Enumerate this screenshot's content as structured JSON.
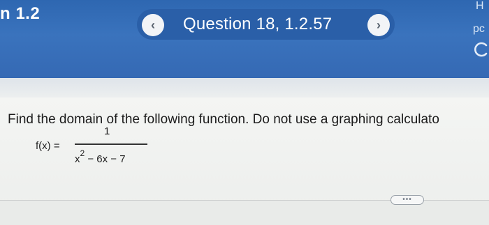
{
  "header": {
    "section_title": "n 1.2",
    "question_label": "Question 18, 1.2.57",
    "prev_glyph": "‹",
    "next_glyph": "›",
    "right_top_text": "H",
    "right_mid_text": "pc",
    "accent_color": "#3a73bd"
  },
  "problem": {
    "instruction": "Find the domain of the following function. Do not use a graphing calculato",
    "function_lhs": "f(x) =",
    "numerator": "1",
    "denominator_base": "x",
    "denominator_exp": "2",
    "denominator_rest": " − 6x − 7"
  },
  "footer": {
    "more_label": "•••"
  }
}
